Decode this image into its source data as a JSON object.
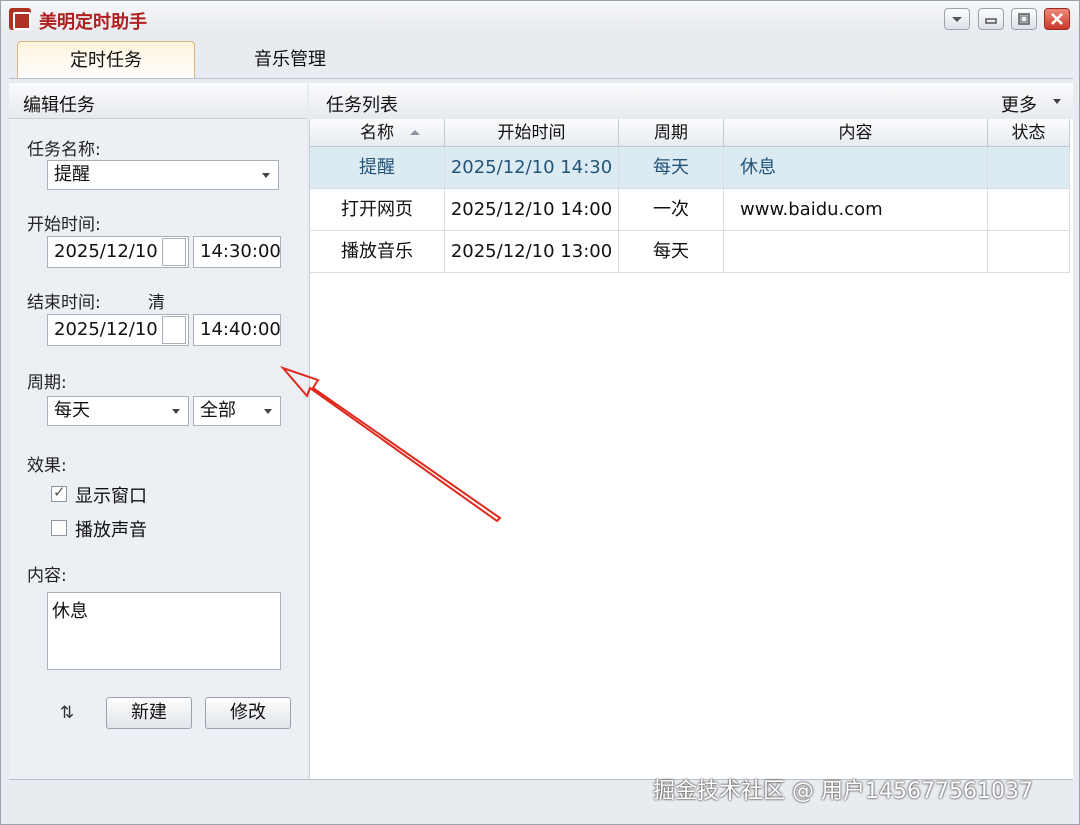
{
  "window": {
    "title": "美明定时助手",
    "brand_color": "#b01e1e"
  },
  "tabs": [
    {
      "label": "定时任务",
      "active": true
    },
    {
      "label": "音乐管理",
      "active": false
    }
  ],
  "edit": {
    "title": "编辑任务",
    "name_label": "任务名称:",
    "name_value": "提醒",
    "start_label": "开始时间:",
    "start_date": "2025/12/10",
    "start_time": "14:30:00",
    "end_label": "结束时间:",
    "end_clear": "清",
    "end_date": "2025/12/10",
    "end_time": "14:40:00",
    "period_label": "周期:",
    "period_value": "每天",
    "period_scope": "全部",
    "effect_label": "效果:",
    "show_window_label": "显示窗口",
    "show_window_checked": true,
    "play_sound_label": "播放声音",
    "play_sound_checked": false,
    "content_label": "内容:",
    "content_value": "休息",
    "new_button": "新建",
    "modify_button": "修改"
  },
  "list": {
    "title": "任务列表",
    "more": "更多",
    "columns": [
      "名称",
      "开始时间",
      "周期",
      "内容",
      "状态"
    ],
    "rows": [
      {
        "name": "提醒",
        "start": "2025/12/10 14:30",
        "period": "每天",
        "content": "休息",
        "status": "",
        "selected": true
      },
      {
        "name": "打开网页",
        "start": "2025/12/10 14:00",
        "period": "一次",
        "content": "www.baidu.com",
        "status": "",
        "selected": false
      },
      {
        "name": "播放音乐",
        "start": "2025/12/10 13:00",
        "period": "每天",
        "content": "",
        "status": "",
        "selected": false
      }
    ]
  },
  "watermark": "掘金技术社区 @ 用户145677561037",
  "annotation_color": "#e02a1e"
}
